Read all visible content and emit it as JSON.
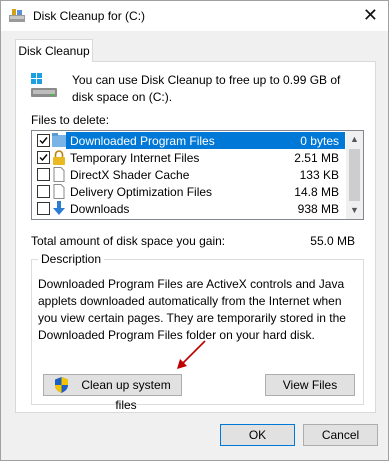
{
  "window": {
    "title": "Disk Cleanup for  (C:)",
    "close_glyph": "✕"
  },
  "tab": {
    "label": "Disk Cleanup"
  },
  "info": {
    "text": "You can use Disk Cleanup to free up to 0.99 GB of disk space on  (C:)."
  },
  "files": {
    "label": "Files to delete:",
    "items": [
      {
        "name": "Downloaded Program Files",
        "size": "0 bytes",
        "checked": true,
        "selected": true,
        "icon": "folder-icon"
      },
      {
        "name": "Temporary Internet Files",
        "size": "2.51 MB",
        "checked": true,
        "selected": false,
        "icon": "lock-icon"
      },
      {
        "name": "DirectX Shader Cache",
        "size": "133 KB",
        "checked": false,
        "selected": false,
        "icon": "document-icon"
      },
      {
        "name": "Delivery Optimization Files",
        "size": "14.8 MB",
        "checked": false,
        "selected": false,
        "icon": "document-icon"
      },
      {
        "name": "Downloads",
        "size": "938 MB",
        "checked": false,
        "selected": false,
        "icon": "download-icon"
      }
    ]
  },
  "total": {
    "label": "Total amount of disk space you gain:",
    "value": "55.0 MB"
  },
  "description": {
    "legend": "Description",
    "text": "Downloaded Program Files are ActiveX controls and Java applets downloaded automatically from the Internet when you view certain pages. They are temporarily stored in the Downloaded Program Files folder on your hard disk."
  },
  "buttons": {
    "cleanup_system": "Clean up system files",
    "view_files": "View Files",
    "ok": "OK",
    "cancel": "Cancel"
  },
  "colors": {
    "selection": "#0078d7",
    "annotation_arrow": "#c00000"
  }
}
